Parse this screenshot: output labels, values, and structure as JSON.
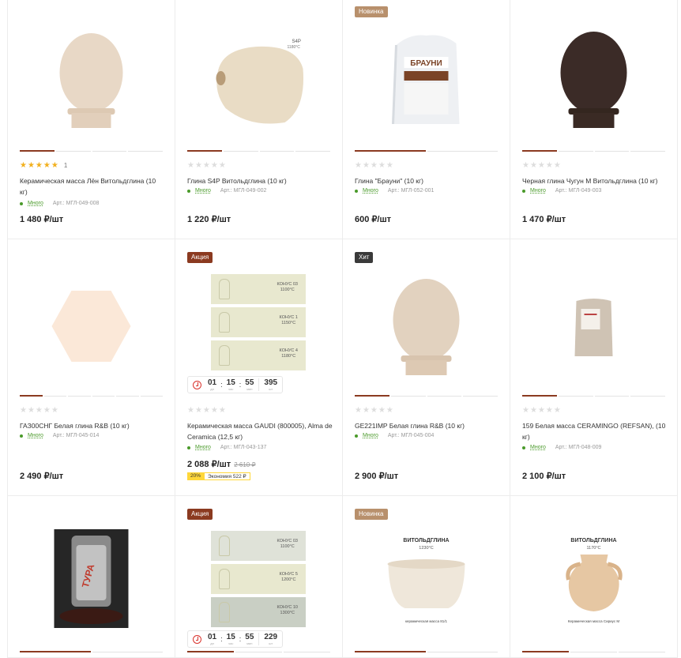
{
  "products": [
    {
      "badge": "",
      "title": "Керамическая масса Лён Витольдглина (10 кг)",
      "rating": 5,
      "reviews": "1",
      "stock": "Много",
      "sku": "Арт.: МГЛ-049-008",
      "price": "1 480 ₽/шт",
      "image": "egg-beige-icon"
    },
    {
      "badge": "",
      "title": "Глина S4P Витольдглина (10 кг)",
      "rating": 0,
      "reviews": "",
      "stock": "Много",
      "sku": "Арт.: МГЛ-049-002",
      "price": "1 220 ₽/шт",
      "image": "vase-beige-icon",
      "img_text": "S4P\n1180°C"
    },
    {
      "badge": "Новинка",
      "title": "Глина \"Брауни\" (10 кг)",
      "rating": 0,
      "reviews": "",
      "stock": "Много",
      "sku": "Арт.: МГЛ-052-001",
      "price": "600 ₽/шт",
      "image": "bag-white-icon",
      "img_text": "БРАУНИ"
    },
    {
      "badge": "",
      "title": "Черная глина Чугун М Витольдглина (10 кг)",
      "rating": 0,
      "reviews": "",
      "stock": "Много",
      "sku": "Арт.: МГЛ-049-003",
      "price": "1 470 ₽/шт",
      "image": "egg-dark-icon"
    },
    {
      "badge": "",
      "title": "ГАЗ00СНГ Белая глина R&B (10 кг)",
      "rating": 0,
      "reviews": "",
      "stock": "Много",
      "sku": "Арт.: МГЛ-045-014",
      "price": "2 490 ₽/шт",
      "image": "hexagon-tile-icon"
    },
    {
      "badge": "Акция",
      "title": "Керамическая масса GAUDI (800005), Alma de Ceramica (12,5 кг)",
      "rating": 0,
      "reviews": "",
      "stock": "Много",
      "sku": "Арт.: МГЛ-043-137",
      "price": "2 088 ₽/шт",
      "old_price": "2 610 ₽",
      "discount": "20%",
      "saving": "Экономия 522 ₽",
      "timer": {
        "d": "01",
        "h": "15",
        "m": "55",
        "q": "395",
        "dl": "дн",
        "hl": "час",
        "ml": "мин",
        "ql": "шт"
      },
      "image": "tiles-icon",
      "tiles": [
        "КОНУС 03\n1100°C",
        "КОНУС 1\n1150°C",
        "КОНУС 4\n1180°C"
      ]
    },
    {
      "badge": "Хит",
      "title": "GE221IMP Белая глина R&B (10 кг)",
      "rating": 0,
      "reviews": "",
      "stock": "Много",
      "sku": "Арт.: МГЛ-045-004",
      "price": "2 900 ₽/шт",
      "image": "egg-beige-icon"
    },
    {
      "badge": "",
      "title": "159 Белая масса CERAMINGO (REFSAN), (10 кг)",
      "rating": 0,
      "reviews": "",
      "stock": "Много",
      "sku": "Арт.: МГЛ-048-009",
      "price": "2 100 ₽/шт",
      "image": "bag-grey-icon"
    },
    {
      "badge": "",
      "title": "",
      "image": "package-black-icon",
      "img_text": "ТУРА"
    },
    {
      "badge": "Акция",
      "title": "",
      "image": "tiles-icon",
      "timer": {
        "d": "01",
        "h": "15",
        "m": "55",
        "q": "229",
        "dl": "дн",
        "hl": "час",
        "ml": "мин",
        "ql": "шт"
      },
      "tiles": [
        "КОНУС 03\n1100°C",
        "КОНУС 5\n1200°C",
        "КОНУС 10\n1300°C"
      ]
    },
    {
      "badge": "Новинка",
      "title": "",
      "image": "bowl-icon",
      "img_text": "ВИТОЛЬДГЛИНА",
      "img_sub": "1230°C",
      "img_caption": "керамическая масса 81/1"
    },
    {
      "badge": "",
      "title": "",
      "image": "jug-icon",
      "img_text": "ВИТОЛЬДГЛИНА",
      "img_sub": "1170°C",
      "img_caption": "Керамическая масса Сириус М"
    }
  ]
}
